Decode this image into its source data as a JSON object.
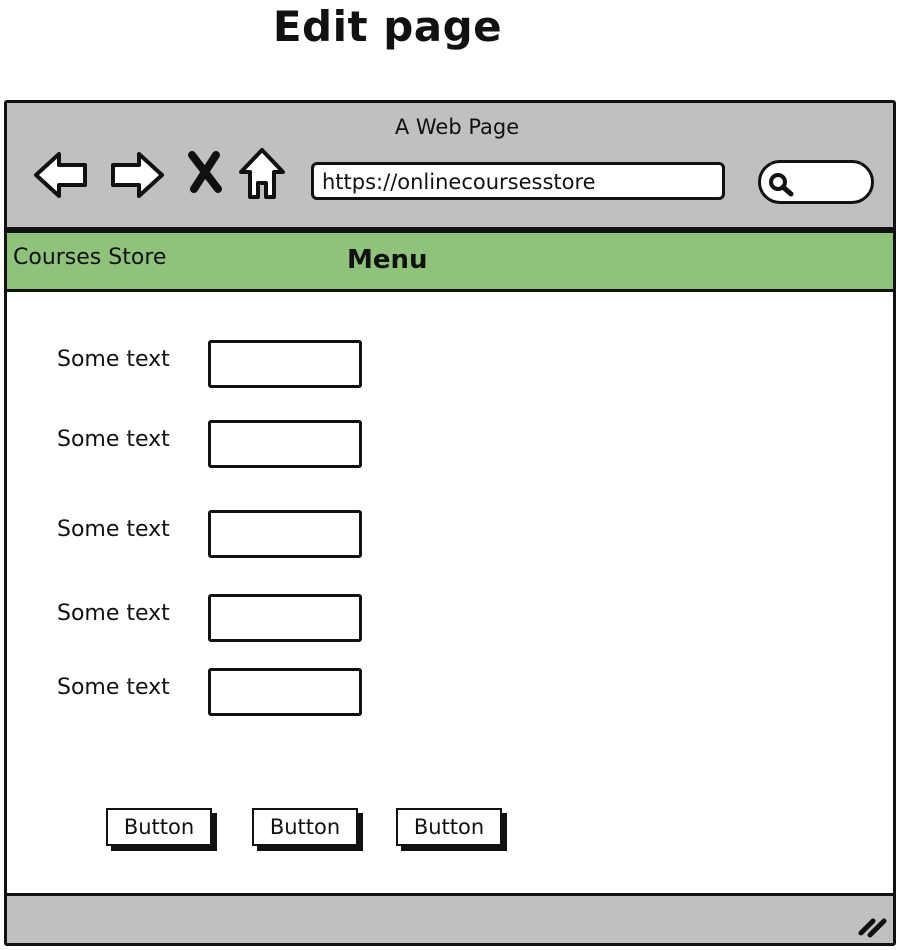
{
  "page": {
    "title": "Edit page"
  },
  "browser": {
    "window_title": "A Web Page",
    "url": "https://onlinecoursesstore",
    "icons": [
      "back-arrow-icon",
      "forward-arrow-icon",
      "stop-icon",
      "home-icon",
      "search-icon",
      "resize-grip-icon"
    ]
  },
  "menubar": {
    "brand": "Courses Store",
    "menu": "Menu",
    "color": "#8fc27a"
  },
  "form": {
    "rows": [
      {
        "label": "Some text",
        "value": ""
      },
      {
        "label": "Some text",
        "value": ""
      },
      {
        "label": "Some text",
        "value": ""
      },
      {
        "label": "Some text",
        "value": ""
      },
      {
        "label": "Some text",
        "value": ""
      }
    ]
  },
  "actions": {
    "buttons": [
      "Button",
      "Button",
      "Button"
    ]
  }
}
